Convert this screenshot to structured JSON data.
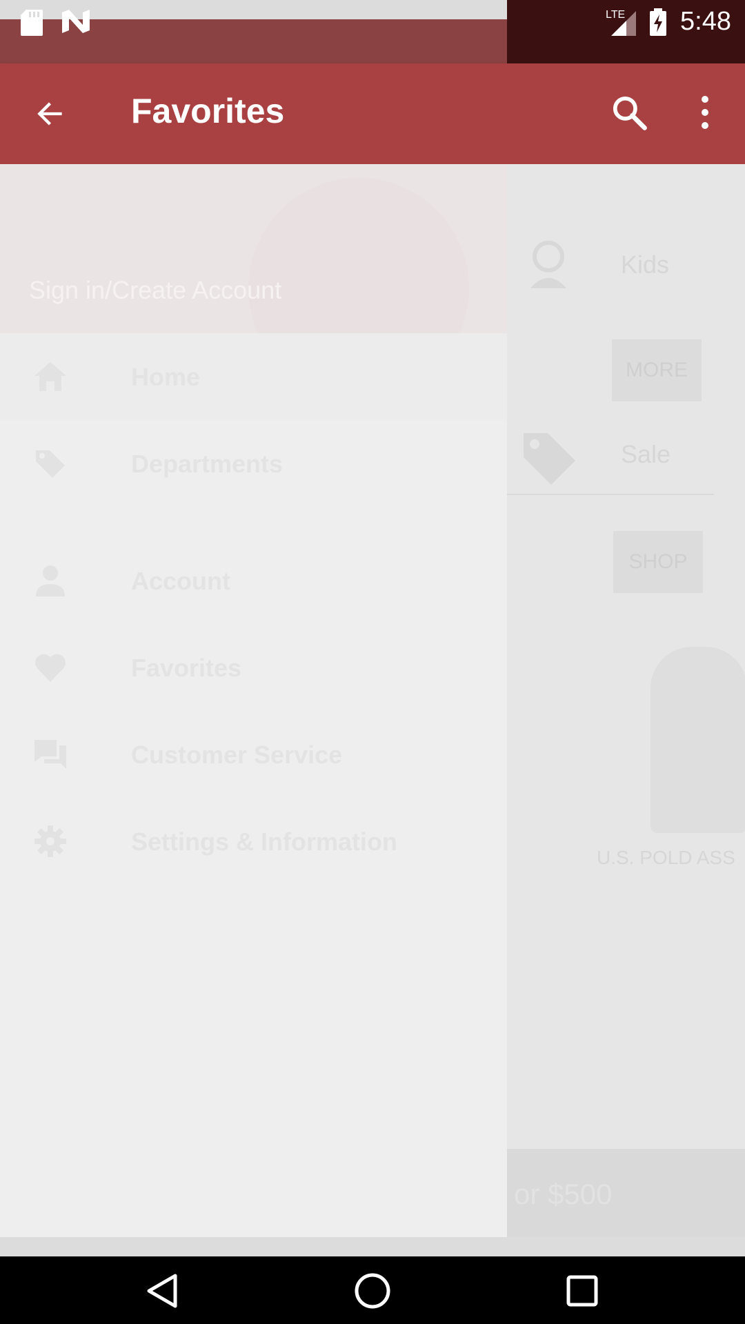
{
  "status_bar": {
    "time": "5:48",
    "network": "LTE",
    "left_icons": [
      "sd-card-icon",
      "n-logo-icon"
    ],
    "right_icons": [
      "signal-icon",
      "battery-charging-icon"
    ]
  },
  "app_bar": {
    "title": "Favorites",
    "back_icon": "arrow-back-icon",
    "search_icon": "search-icon",
    "more_icon": "more-vert-icon",
    "color": "#a94142"
  },
  "drawer": {
    "header": {
      "sign_in_label": "Sign in/Create Account"
    },
    "items": [
      {
        "label": "Home",
        "icon": "home-icon",
        "active": true
      },
      {
        "label": "Departments",
        "icon": "tag-icon",
        "active": false
      },
      {
        "label": "Account",
        "icon": "person-icon",
        "active": false
      },
      {
        "label": "Favorites",
        "icon": "heart-icon",
        "active": false
      },
      {
        "label": "Customer Service",
        "icon": "chat-icon",
        "active": false
      },
      {
        "label": "Settings & Information",
        "icon": "gear-icon",
        "active": false
      }
    ]
  },
  "background_page": {
    "kids_label": "Kids",
    "more_label": "MORE",
    "sale_label": "Sale",
    "shop_label": "SHOP",
    "brand_text": "U.S. POLD ASS",
    "price_text": "or $500"
  },
  "nav_bar": {
    "back": "back-triangle-icon",
    "home": "home-circle-icon",
    "recents": "recents-square-icon"
  }
}
